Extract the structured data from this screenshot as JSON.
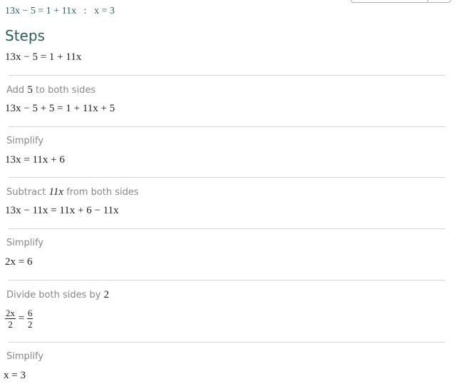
{
  "header": {
    "equation": "13x − 5 = 1 + 11x",
    "separator": ":",
    "solution": "x = 3"
  },
  "steps_title": "Steps",
  "initial": "13x − 5 = 1 + 11x",
  "steps": [
    {
      "label_pre": "Add ",
      "label_math": "5",
      "label_post": " to both sides",
      "result": "13x − 5 + 5 = 1 + 11x + 5"
    },
    {
      "label_pre": "Simplify",
      "label_math": "",
      "label_post": "",
      "result": "13x = 11x + 6"
    },
    {
      "label_pre": "Subtract ",
      "label_math": "11x",
      "label_post": " from both sides",
      "result": "13x − 11x = 11x + 6 − 11x"
    },
    {
      "label_pre": "Simplify",
      "label_math": "",
      "label_post": "",
      "result": "2x = 6"
    },
    {
      "label_pre": "Divide both sides by ",
      "label_math": "2",
      "label_post": "",
      "result_fraction": {
        "left_num": "2x",
        "left_den": "2",
        "eq": "=",
        "right_num": "6",
        "right_den": "2"
      }
    },
    {
      "label_pre": "Simplify",
      "label_math": "",
      "label_post": "",
      "result": "x = 3"
    }
  ]
}
